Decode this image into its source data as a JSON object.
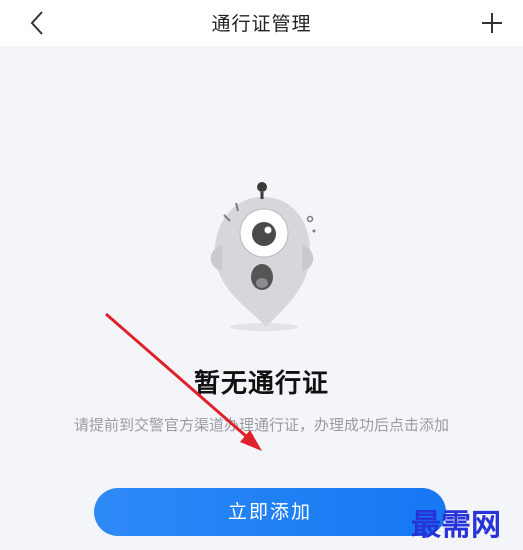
{
  "header": {
    "title": "通行证管理",
    "back_icon": "chevron-left-icon",
    "add_icon": "plus-icon"
  },
  "empty_state": {
    "illustration": "crying-ghost-mascot",
    "title": "暂无通行证",
    "hint": "请提前到交警官方渠道办理通行证，办理成功后点击添加"
  },
  "actions": {
    "add_label": "立即添加"
  },
  "overlay": {
    "annotation": "red-arrow-pointing-to-add-button",
    "watermark_text": "最需网"
  },
  "colors": {
    "background": "#f4f5f9",
    "navbar": "#ffffff",
    "accent": "#1677f3",
    "annotation": "#e0202a",
    "watermark": "#2533d8"
  }
}
